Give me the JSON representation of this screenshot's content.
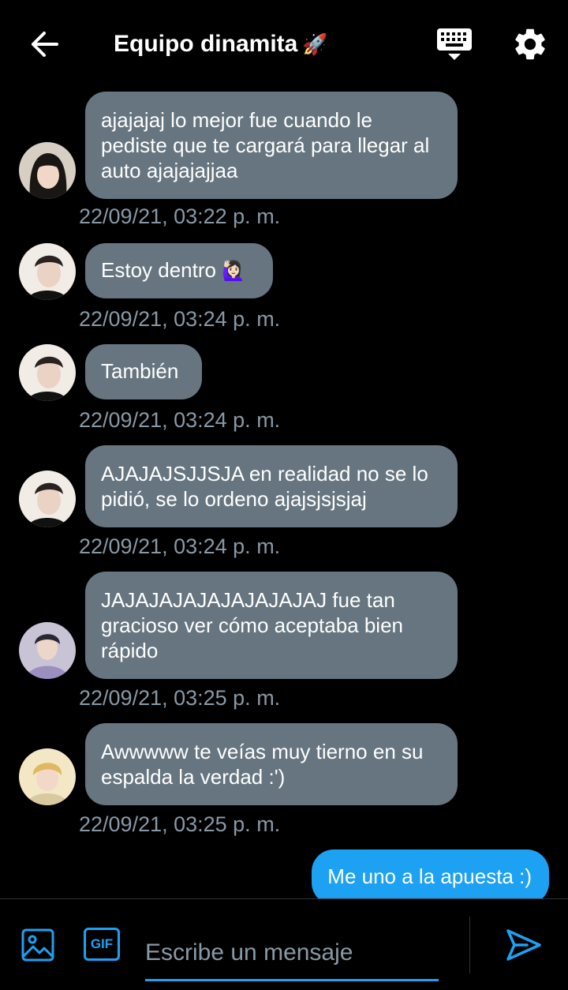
{
  "header": {
    "back_icon": "arrow-left-icon",
    "title": "Equipo dinamita",
    "title_emoji": "🚀",
    "keyboard_icon": "keyboard-icon",
    "settings_icon": "gear-icon"
  },
  "messages": [
    {
      "text": "ajajajaj lo mejor fue cuando le pediste que te cargará para llegar al auto ajajajajjaa",
      "timestamp": "22/09/21, 03:22 p. m."
    },
    {
      "text": "Estoy dentro",
      "emoji": "🙋🏻‍♀️",
      "timestamp": "22/09/21, 03:24 p. m."
    },
    {
      "text": "También",
      "timestamp": "22/09/21, 03:24 p. m."
    },
    {
      "text": "AJAJAJSJJSJA en realidad no se lo pidió, se lo ordeno ajajsjsjsjaj",
      "timestamp": "22/09/21, 03:24 p. m."
    },
    {
      "text": "JAJAJAJAJAJAJAJAJAJ fue tan gracioso ver cómo aceptaba bien rápido",
      "timestamp": "22/09/21, 03:25 p. m."
    },
    {
      "text": "Awwwww te veías muy tierno en su espalda la verdad :')",
      "timestamp": "22/09/21, 03:25 p. m."
    }
  ],
  "own_message": {
    "text": "Me uno a la apuesta :)"
  },
  "composer": {
    "image_icon": "image-icon",
    "gif_label": "GIF",
    "placeholder": "Escribe un mensaje",
    "send_icon": "send-icon"
  },
  "colors": {
    "background": "#000000",
    "bubble_received": "#66757f",
    "bubble_sent": "#1da1f2",
    "accent": "#1da1f2",
    "timestamp": "#8899a6"
  }
}
